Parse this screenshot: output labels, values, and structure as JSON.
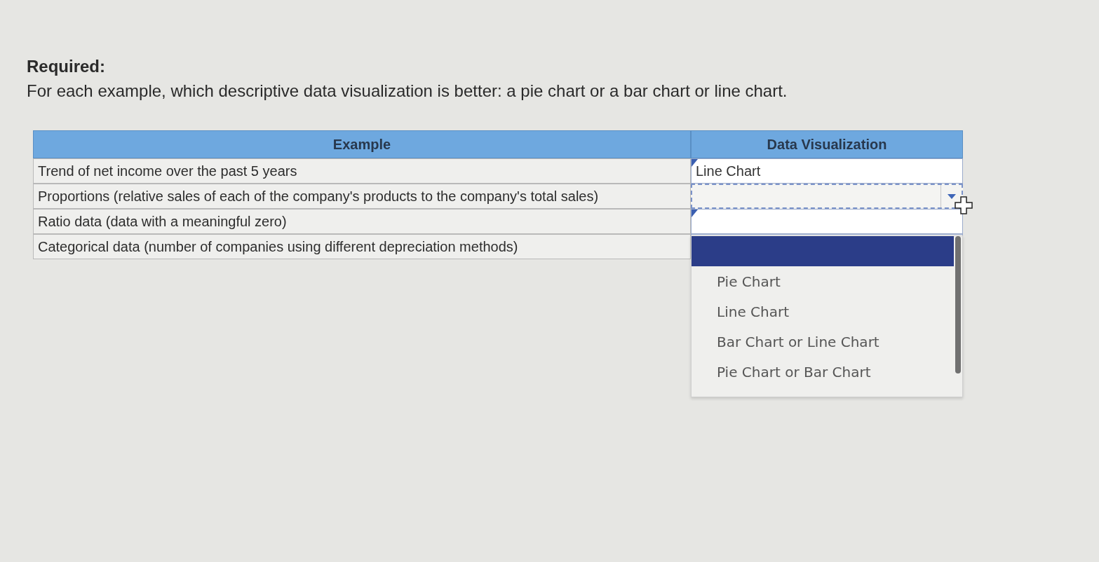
{
  "instructions": {
    "heading": "Required:",
    "text": "For each example, which descriptive data visualization is better: a pie chart or a bar chart or line chart."
  },
  "table": {
    "columns": [
      "Example",
      "Data Visualization"
    ],
    "rows": [
      {
        "example": "Trend of net income over the past 5 years",
        "answer": "Line Chart",
        "answered": true,
        "focused": false
      },
      {
        "example": "Proportions (relative sales of each of the company's products to the company's total sales)",
        "answered": false,
        "focused": true
      },
      {
        "example": "Ratio data (data with a meaningful zero)",
        "answered": true,
        "focused": false
      },
      {
        "example": "Categorical data (number of companies using different depreciation methods)",
        "answered": false,
        "focused": false
      }
    ]
  },
  "dropdown": {
    "open": true,
    "options": [
      {
        "selected": true
      },
      {
        "label": "Pie Chart",
        "selected": false
      },
      {
        "label": "Line Chart",
        "selected": false
      },
      {
        "label": "Bar Chart or Line Chart",
        "selected": false
      },
      {
        "label": "Pie Chart or Bar Chart",
        "selected": false
      }
    ]
  }
}
